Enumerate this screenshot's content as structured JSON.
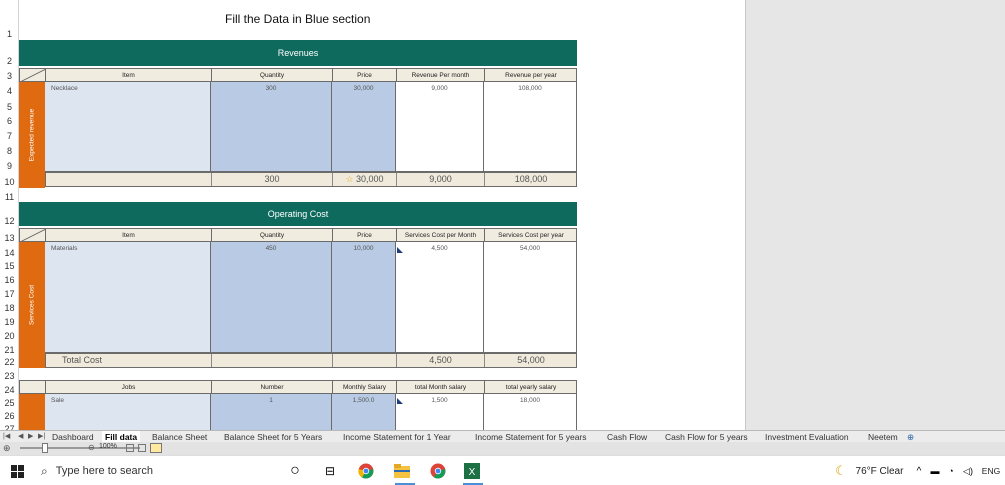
{
  "sheet": {
    "title": "Fill the Data in Blue section",
    "row_numbers": [
      "1",
      "2",
      "3",
      "4",
      "5",
      "6",
      "7",
      "8",
      "9",
      "10",
      "11",
      "12",
      "13",
      "14",
      "15",
      "16",
      "17",
      "18",
      "19",
      "20",
      "21",
      "22",
      "23",
      "24",
      "25",
      "26",
      "27"
    ],
    "revenues": {
      "band": "Revenues",
      "side_label": "Expected revenue",
      "headers": [
        "Item",
        "Quantity",
        "Price",
        "Revenue Per month",
        "Revenue per year"
      ],
      "row": [
        "Necklace",
        "300",
        "30,000",
        "9,000",
        "108,000"
      ],
      "totals": {
        "quantity": "300",
        "price": "30,000",
        "month": "9,000",
        "year": "108,000"
      }
    },
    "operating": {
      "band": "Operating Cost",
      "side_label": "Services Cost",
      "headers": [
        "Item",
        "Quantity",
        "Price",
        "Services Cost per Month",
        "Services Cost per year"
      ],
      "row": [
        "Materials",
        "450",
        "10,000",
        "4,500",
        "54,000"
      ],
      "totals": {
        "label": "Total Cost",
        "month": "4,500",
        "year": "54,000"
      }
    },
    "salaries": {
      "headers": [
        "Jobs",
        "Number",
        "Monthly Salary",
        "total Month salary",
        "total yearly salary"
      ],
      "row": [
        "Sale",
        "1",
        "1,500.0",
        "1,500",
        "18,000"
      ]
    }
  },
  "tabs": [
    "Dashboard",
    "Fill data",
    "Balance Sheet",
    "Balance Sheet for 5 Years",
    "Income Statement for 1 Year",
    "Income Statement for 5 years",
    "Cash Flow",
    "Cash Flow for 5 years",
    "Investment Evaluation",
    "Neetem"
  ],
  "active_tab": "Fill data",
  "status": {
    "zoom": "100%"
  },
  "taskbar": {
    "search_placeholder": "Type here to search",
    "weather": "76°F  Clear",
    "lang": "ENG"
  },
  "colors": {
    "teal": "#0f6a5e",
    "orange": "#e06a10",
    "blue_input": "#b9cbe4",
    "light_blue": "#dce5f0"
  }
}
